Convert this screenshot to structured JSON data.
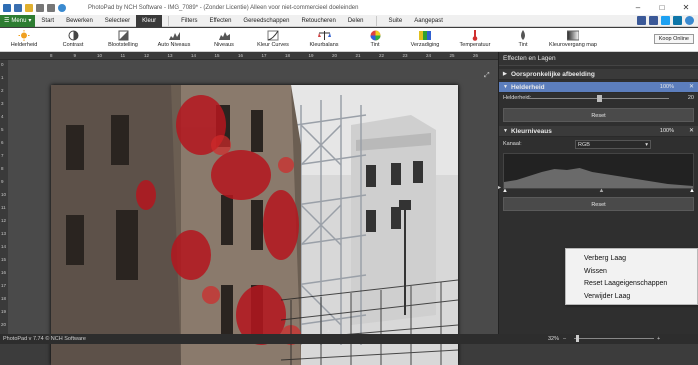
{
  "window": {
    "title": "PhotoPad by NCH Software - IMG_7089* - (Zonder Licentie) Alleen voor niet-commercieel doeleinden",
    "controls": [
      "–",
      "□",
      "✕"
    ]
  },
  "menubar": {
    "menu_label": "Menu",
    "tabs": [
      {
        "label": "Start",
        "active": false
      },
      {
        "label": "Bewerken",
        "active": false
      },
      {
        "label": "Selecteer",
        "active": false
      },
      {
        "label": "Kleur",
        "active": true
      },
      {
        "label": "Filters",
        "active": false
      },
      {
        "label": "Effecten",
        "active": false
      },
      {
        "label": "Gereedschappen",
        "active": false
      },
      {
        "label": "Retoucheren",
        "active": false
      },
      {
        "label": "Delen",
        "active": false
      },
      {
        "label": "Suite",
        "active": false
      },
      {
        "label": "Aangepast",
        "active": false
      }
    ]
  },
  "toolbar": {
    "tools": [
      {
        "label": "Helderheid",
        "icon": "sun-icon",
        "color": "#f0a020"
      },
      {
        "label": "Contrast",
        "icon": "contrast-icon",
        "color": "#444444"
      },
      {
        "label": "Blootstelling",
        "icon": "exposure-icon",
        "color": "#555555"
      },
      {
        "label": "Auto Niveaus",
        "icon": "auto-levels-icon",
        "color": "#555555"
      },
      {
        "label": "Niveaus",
        "icon": "levels-icon",
        "color": "#555555"
      },
      {
        "label": "Kleur Curves",
        "icon": "curves-icon",
        "color": "#555555"
      },
      {
        "label": "Kleurbalans",
        "icon": "color-balance-icon",
        "color": "#d04040"
      },
      {
        "label": "Tint",
        "icon": "color-wheel-icon",
        "color": "#c03030"
      },
      {
        "label": "Verzadiging",
        "icon": "saturation-icon",
        "color": "#30a030"
      },
      {
        "label": "Temperatuur",
        "icon": "thermometer-icon",
        "color": "#d03030"
      },
      {
        "label": "Tint",
        "icon": "drop-icon",
        "color": "#555555"
      },
      {
        "label": "Kleurovergang map",
        "icon": "gradient-map-icon",
        "color": "#555555"
      }
    ],
    "online_label": "Koop Online"
  },
  "ruler": {
    "top": [
      "8",
      "9",
      "10",
      "11",
      "12",
      "13",
      "14",
      "15",
      "16",
      "17",
      "18",
      "19",
      "20",
      "21",
      "22",
      "23",
      "24",
      "25",
      "26"
    ],
    "left": [
      "0",
      "1",
      "2",
      "3",
      "4",
      "5",
      "6",
      "7",
      "8",
      "9",
      "10",
      "11",
      "12",
      "13",
      "14",
      "15",
      "16",
      "17",
      "18",
      "19",
      "20"
    ]
  },
  "panel": {
    "title": "Effecten en Lagen",
    "original_layer": "Oorspronkelijke afbeelding",
    "brightness": {
      "name": "Helderheid",
      "percent": "100%",
      "prop_label": "Helderheid:",
      "value": "20",
      "reset": "Reset"
    },
    "levels": {
      "name": "Kleurniveaus",
      "percent": "100%",
      "channel_label": "Kanaal:",
      "channel_value": "RGB",
      "reset": "Reset"
    }
  },
  "context_menu": {
    "items": [
      "Verberg Laag",
      "Wissen",
      "Reset Laageigenschappen",
      "Verwijder Laag"
    ]
  },
  "status": {
    "version": "PhotoPad v 7.74 © NCH Software",
    "zoom": "32%"
  },
  "colors": {
    "accent": "#5c7ebd",
    "menu_green": "#2e7d32"
  }
}
